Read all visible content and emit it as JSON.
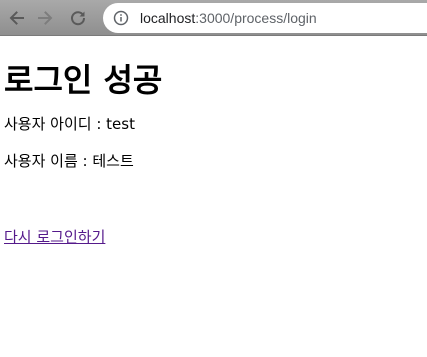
{
  "browser": {
    "url_host": "localhost",
    "url_path": ":3000/process/login"
  },
  "page": {
    "heading": "로그인 성공",
    "user_id_line": "사용자 아이디 : test",
    "user_name_line": "사용자 이름 : 테스트",
    "relogin_link": "다시 로그인하기"
  }
}
